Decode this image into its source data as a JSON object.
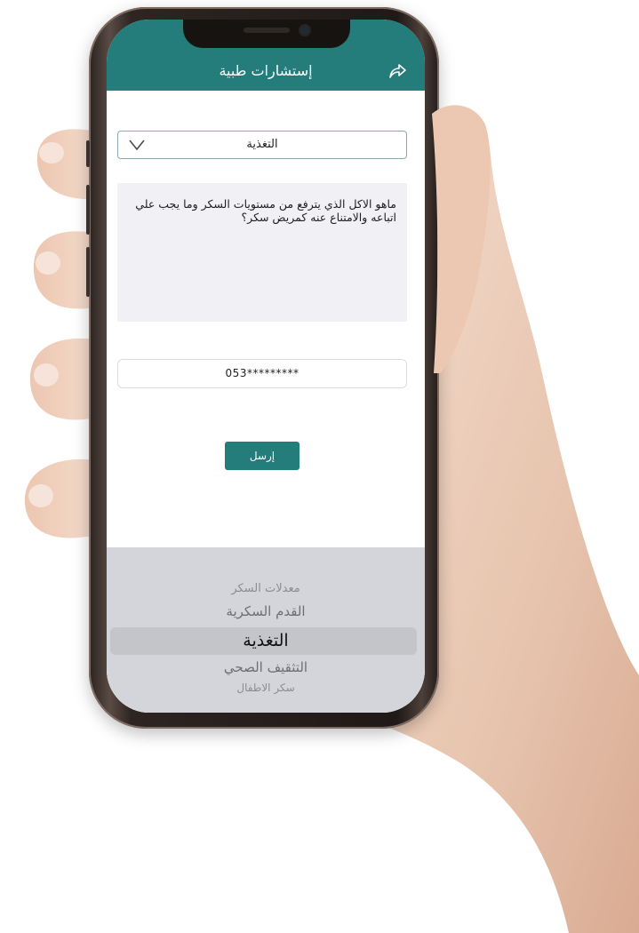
{
  "app": {
    "title": "إستشارات طبية",
    "accent_color": "#257d7b"
  },
  "form": {
    "category_selected": "التغذية",
    "message_text": "ماهو الاكل الذي يترفع من مستويات السكر وما يجب علي اتباعه والامتناع عنه كمريض سكر؟",
    "phone_value": "053*********",
    "send_label": "إرسل"
  },
  "picker": {
    "options": [
      "معدلات السكر",
      "القدم السكرية",
      "التغذية",
      "التثقيف الصحي",
      "سكر الاطفال"
    ],
    "selected_index": 2
  },
  "icons": {
    "share": "share-icon",
    "dropdown": "chevron-down-icon"
  }
}
